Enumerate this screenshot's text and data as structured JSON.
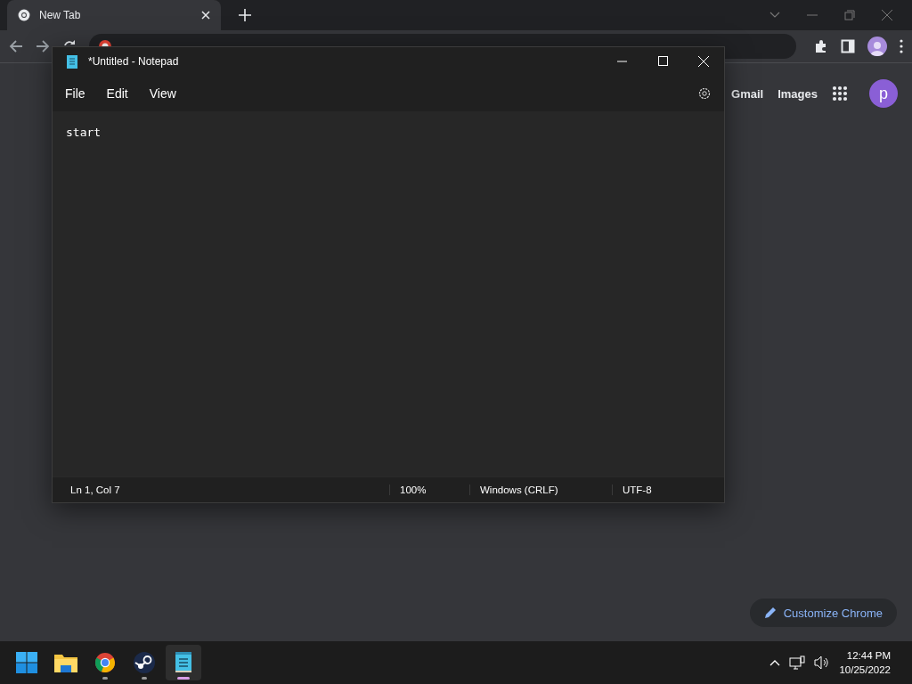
{
  "browser": {
    "tabs": [
      {
        "title": "New Tab",
        "selected": true
      }
    ],
    "links": [
      "Gmail",
      "Images"
    ],
    "account_initial": "p",
    "customize_button": "Customize Chrome"
  },
  "notepad": {
    "title": "*Untitled - Notepad",
    "menu": [
      "File",
      "Edit",
      "View"
    ],
    "content": "start",
    "status": [
      "Ln 1, Col 7",
      "100%",
      "Windows (CRLF)",
      "UTF-8"
    ]
  },
  "taskbar": {
    "apps": [
      {
        "kind": "start",
        "running": false,
        "selected": false
      },
      {
        "kind": "explorer",
        "running": false,
        "selected": false
      },
      {
        "kind": "chrome",
        "running": true,
        "selected": false
      },
      {
        "kind": "steam",
        "running": true,
        "selected": false
      },
      {
        "kind": "notepad",
        "running": true,
        "selected": true
      }
    ],
    "time": "12:44 PM",
    "date": "10/25/2022"
  }
}
